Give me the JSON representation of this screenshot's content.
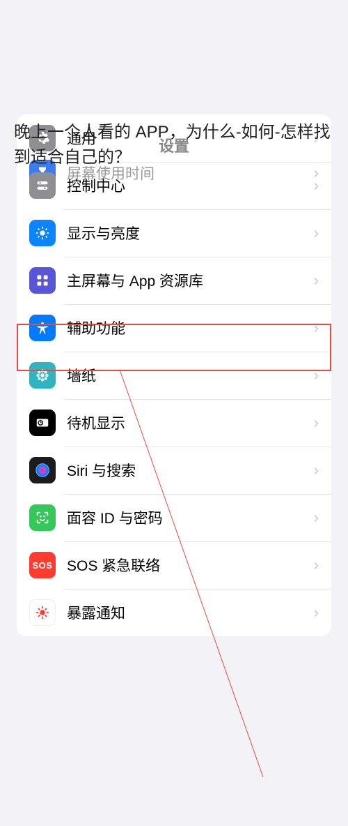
{
  "overlay_text": "晚上一个人看的 APP，为什么-如何-怎样找到适合自己的？",
  "header_title": "设置",
  "top_group": {
    "screen_time": "屏幕使用时间"
  },
  "main_group": {
    "items": [
      {
        "label": "通用",
        "icon": "gear"
      },
      {
        "label": "控制中心",
        "icon": "toggles"
      },
      {
        "label": "显示与亮度",
        "icon": "brightness",
        "highlighted": true
      },
      {
        "label": "主屏幕与 App 资源库",
        "icon": "homegrid"
      },
      {
        "label": "辅助功能",
        "icon": "accessibility"
      },
      {
        "label": "墙纸",
        "icon": "flower"
      },
      {
        "label": "待机显示",
        "icon": "clock"
      },
      {
        "label": "Siri 与搜索",
        "icon": "siri"
      },
      {
        "label": "面容 ID 与密码",
        "icon": "faceid"
      },
      {
        "label": "SOS 紧急联络",
        "icon": "sos"
      },
      {
        "label": "暴露通知",
        "icon": "sun"
      }
    ]
  },
  "sos_text": "SOS"
}
